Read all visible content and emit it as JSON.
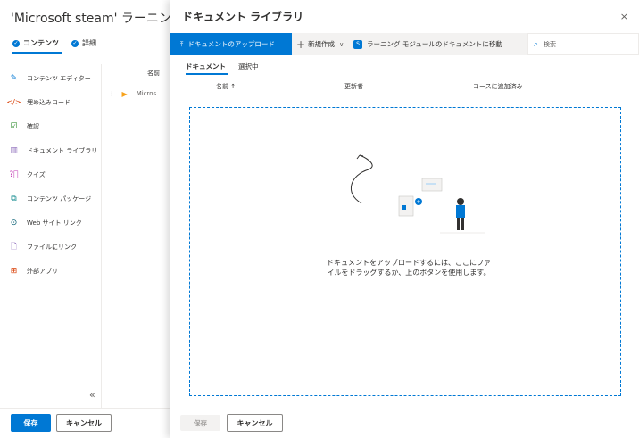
{
  "background": {
    "title": "'Microsoft steam' ラーニング モジュ",
    "tabs": [
      {
        "label": "コンテンツ"
      },
      {
        "label": "詳細"
      }
    ],
    "sidebar": {
      "items": [
        {
          "label": "コンテンツ エディター",
          "icon": "edit-icon",
          "color": "#0078d4"
        },
        {
          "label": "埋め込みコード",
          "icon": "code-icon",
          "color": "#d83b01"
        },
        {
          "label": "確認",
          "icon": "checklist-icon",
          "color": "#107c10"
        },
        {
          "label": "ドキュメント ライブラリ",
          "icon": "library-icon",
          "color": "#8764b8"
        },
        {
          "label": "クイズ",
          "icon": "quiz-icon",
          "color": "#c239b3"
        },
        {
          "label": "コンテンツ パッケージ",
          "icon": "package-icon",
          "color": "#038387"
        },
        {
          "label": "Web サイト リンク",
          "icon": "web-link-icon",
          "color": "#005b70"
        },
        {
          "label": "ファイルにリンク",
          "icon": "file-link-icon",
          "color": "#8764b8"
        },
        {
          "label": "外部アプリ",
          "icon": "external-app-icon",
          "color": "#d83b01"
        }
      ],
      "collapse_icon": "«"
    },
    "list": {
      "header": "名前",
      "row": "Micros"
    },
    "footer": {
      "save": "保存",
      "cancel": "キャンセル"
    }
  },
  "panel": {
    "title": "ドキュメント ライブラリ",
    "close": "×",
    "commands": {
      "upload": "ドキュメントのアップロード",
      "new": "新規作成",
      "goto": "ラーニング モジュールのドキュメントに移動",
      "search_placeholder": "検索"
    },
    "tabs": [
      {
        "label": "ドキュメント"
      },
      {
        "label": "選択中"
      }
    ],
    "columns": {
      "name": "名前 ↑",
      "modified_by": "更新者",
      "added": "コースに追加済み"
    },
    "dropzone": {
      "text": "ドキュメントをアップロードするには、ここにファイルをドラッグするか、上のボタンを使用します。"
    },
    "footer": {
      "save": "保存",
      "cancel": "キャンセル"
    }
  },
  "colors": {
    "accent": "#0078d4",
    "text": "#323130",
    "muted": "#605e5c"
  }
}
